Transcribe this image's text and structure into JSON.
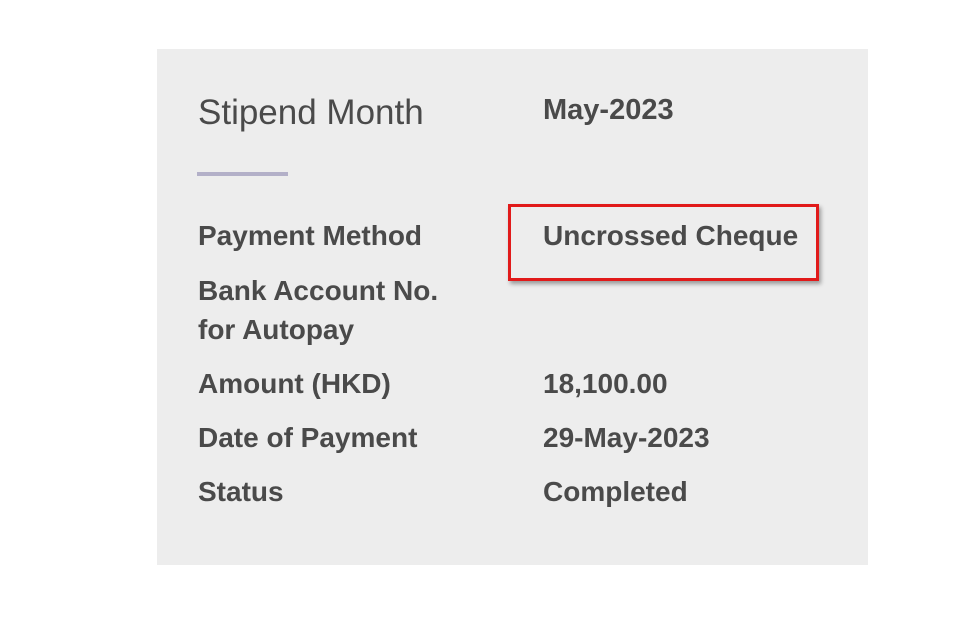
{
  "stipend": {
    "month_label": "Stipend Month",
    "month_value": "May-2023"
  },
  "rows": [
    {
      "label": "Payment Method",
      "value": "Uncrossed Cheque"
    },
    {
      "label_line1": "Bank Account No.",
      "label_line2": "for Autopay",
      "value": ""
    },
    {
      "label": "Amount (HKD)",
      "value": "18,100.00"
    },
    {
      "label": "Date of Payment",
      "value": "29-May-2023"
    },
    {
      "label": "Status",
      "value": "Completed"
    }
  ],
  "colors": {
    "card_background": "#ededed",
    "text": "#4a4a4a",
    "divider": "#b3b0c8",
    "highlight_border": "#e11a1a"
  }
}
